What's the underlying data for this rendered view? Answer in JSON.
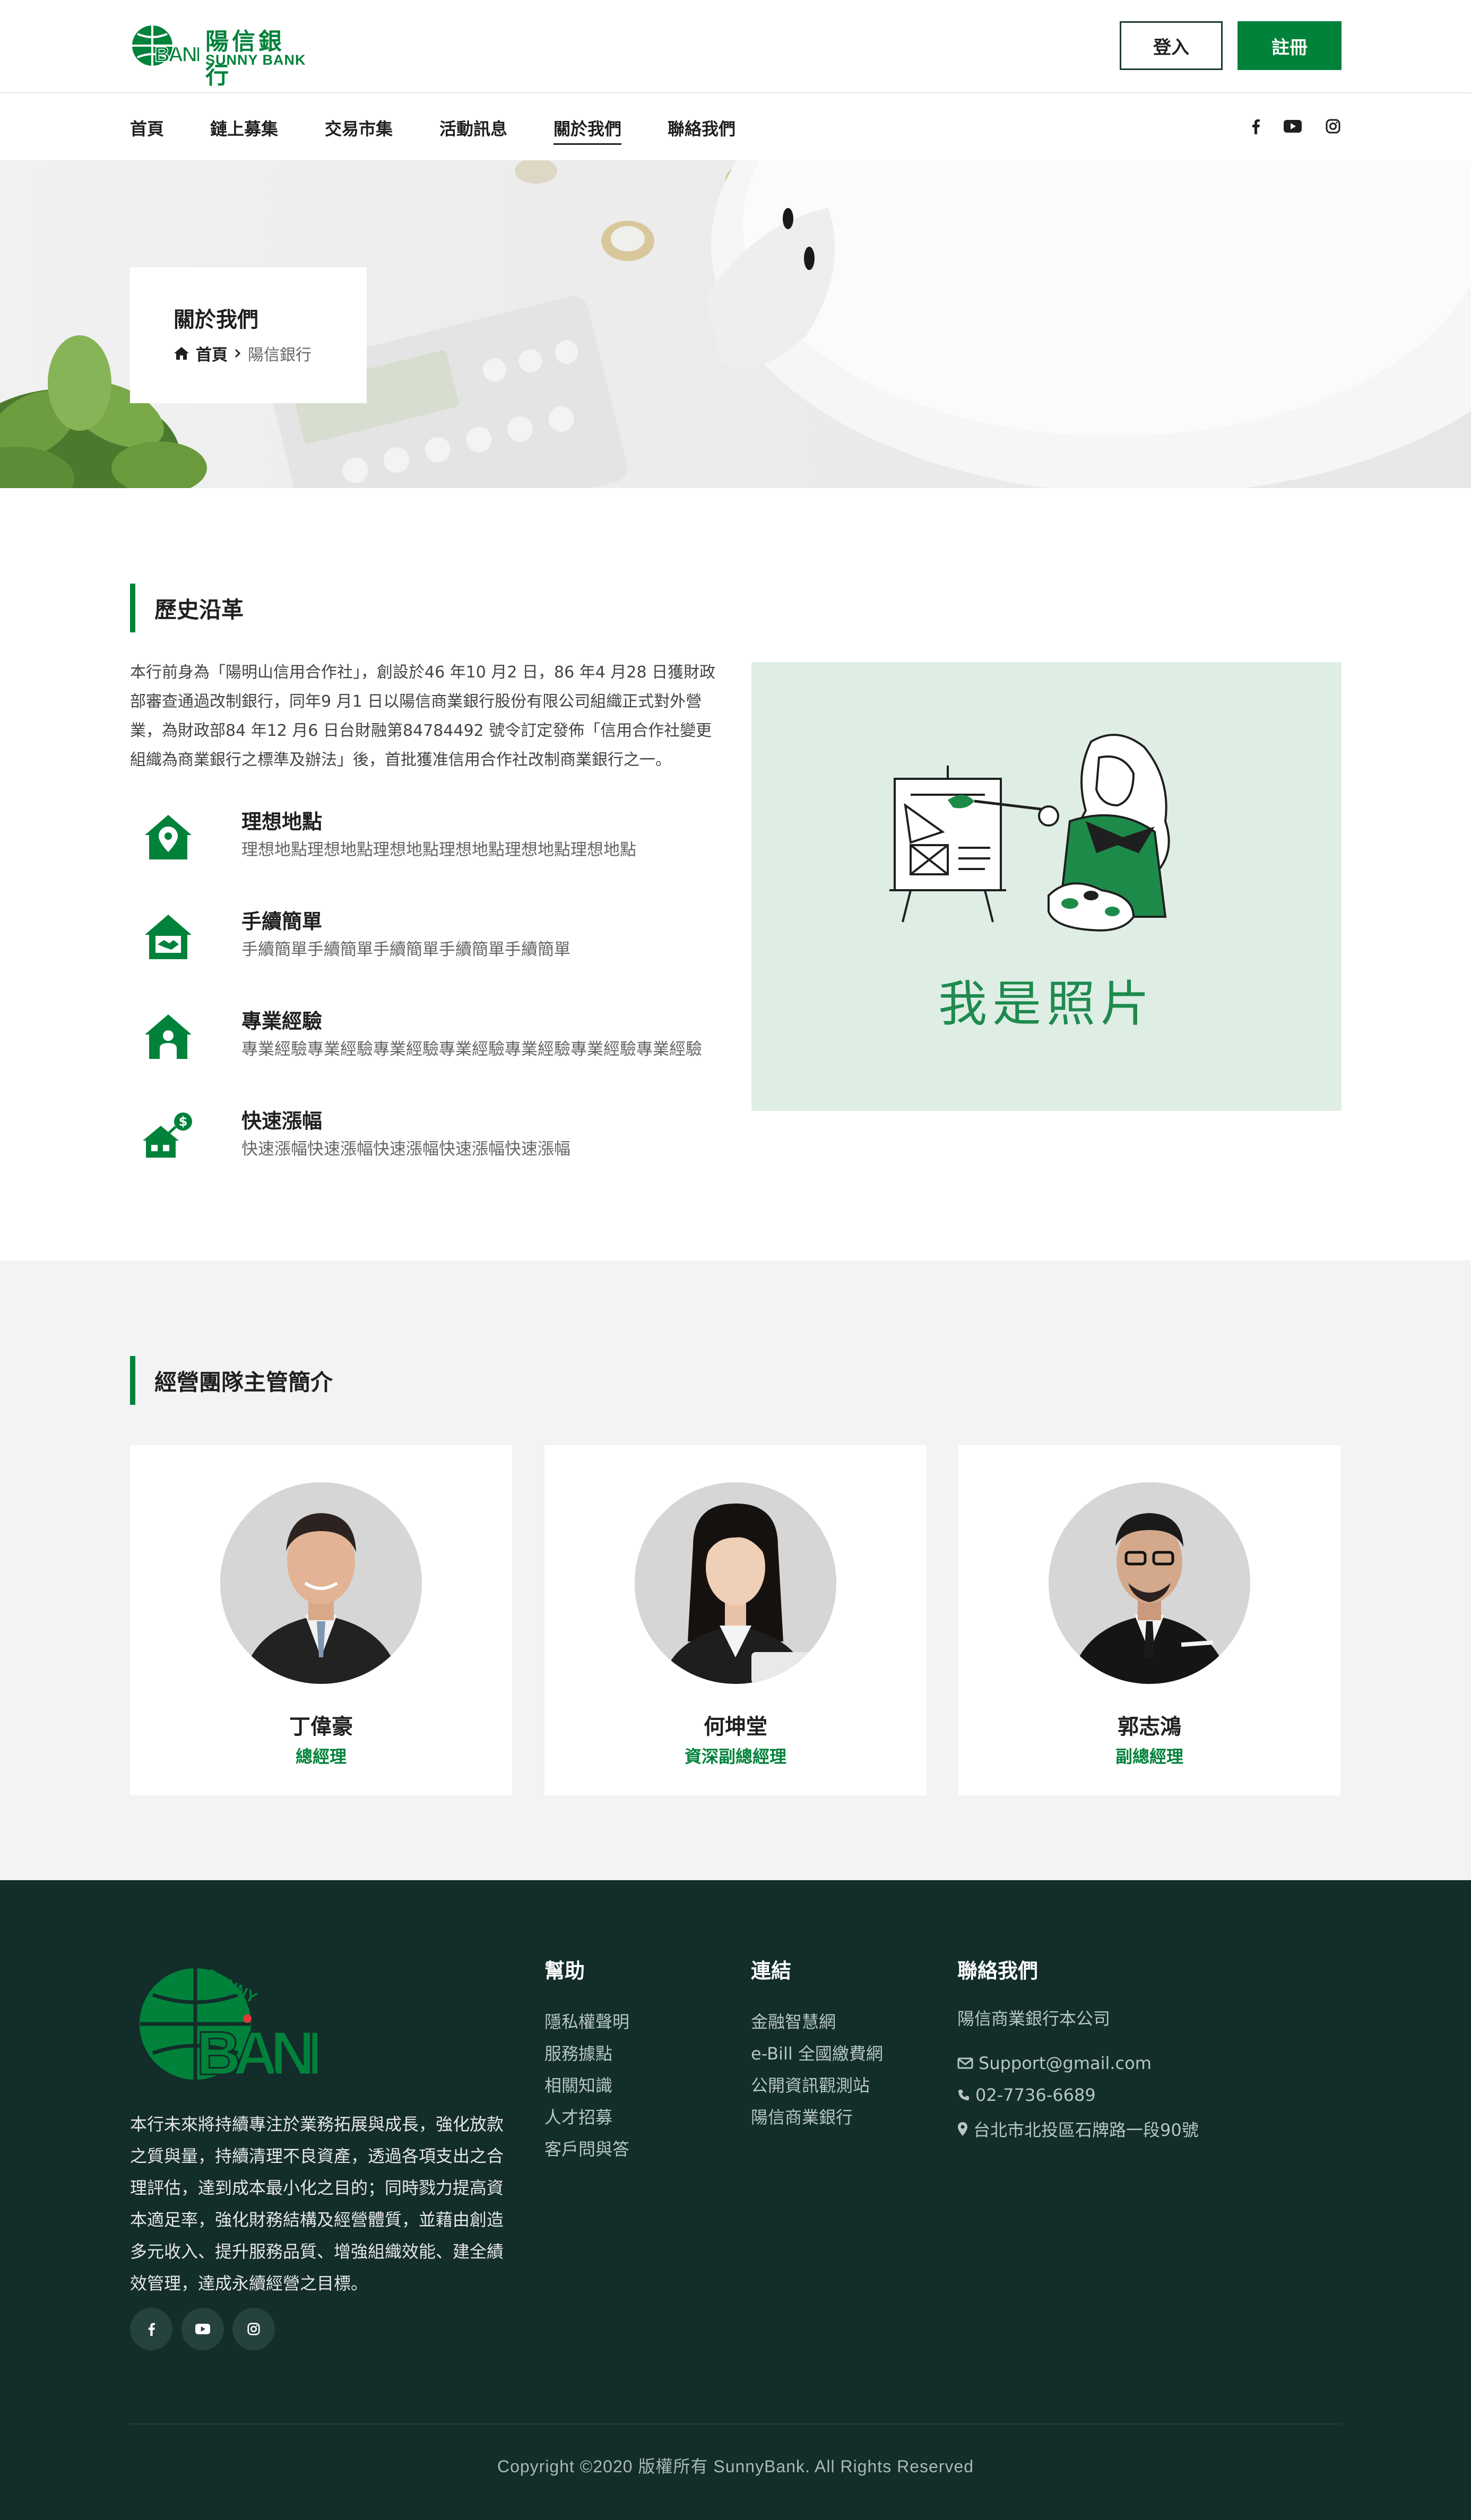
{
  "brand": {
    "name_cn": "陽信銀行",
    "name_en": "SUNNY BANK",
    "logo_mark": "BANK",
    "primary_color": "#00823b",
    "footer_bg": "#122d2a"
  },
  "header": {
    "login_label": "登入",
    "register_label": "註冊"
  },
  "nav": {
    "items": [
      {
        "label": "首頁"
      },
      {
        "label": "鏈上募集"
      },
      {
        "label": "交易市集"
      },
      {
        "label": "活動訊息"
      },
      {
        "label": "關於我們",
        "active": true
      },
      {
        "label": "聯絡我們"
      }
    ],
    "social_icons": [
      "facebook-icon",
      "youtube-icon",
      "instagram-icon"
    ]
  },
  "hero": {
    "title": "關於我們",
    "breadcrumb_home": "首頁",
    "breadcrumb_current": "陽信銀行"
  },
  "history": {
    "heading": "歷史沿革",
    "body": "本行前身為「陽明山信用合作社」，創設於46 年10 月2 日，86 年4 月28 日獲財政部審查通過改制銀行，同年9 月1 日以陽信商業銀行股份有限公司組織正式對外營業，為財政部84 年12 月6 日台財融第84784492 號令訂定發佈「信用合作社變更組織為商業銀行之標準及辦法」後，首批獲准信用合作社改制商業銀行之一。",
    "features": [
      {
        "title": "理想地點",
        "desc": "理想地點理想地點理想地點理想地點理想地點理想地點",
        "icon": "house-location-icon"
      },
      {
        "title": "手續簡單",
        "desc": "手續簡單手續簡單手續簡單手續簡單手續簡單",
        "icon": "house-handshake-icon"
      },
      {
        "title": "專業經驗",
        "desc": "專業經驗專業經驗專業經驗專業經驗專業經驗專業經驗專業經驗",
        "icon": "house-person-icon"
      },
      {
        "title": "快速漲幅",
        "desc": "快速漲幅快速漲幅快速漲幅快速漲幅快速漲幅",
        "icon": "house-growth-icon"
      }
    ],
    "photo_caption": "我是照片"
  },
  "team": {
    "heading": "經營團隊主管簡介",
    "members": [
      {
        "name": "丁偉豪",
        "role": "總經理"
      },
      {
        "name": "何坤堂",
        "role": "資深副總經理"
      },
      {
        "name": "郭志鴻",
        "role": "副總經理"
      }
    ]
  },
  "footer": {
    "logo_text": "SUNNY",
    "about": "本行未來將持續專注於業務拓展與成長，強化放款之質與量，持續清理不良資產，透過各項支出之合理評估，達到成本最小化之目的；同時戮力提高資本適足率，強化財務結構及經營體質，並藉由創造多元收入、提升服務品質、增強組織效能、建全績效管理，達成永續經營之目標。",
    "help": {
      "title": "幫助",
      "links": [
        "隱私權聲明",
        "服務據點",
        "相關知識",
        "人才招募",
        "客戶問與答"
      ]
    },
    "links": {
      "title": "連結",
      "links": [
        "金融智慧網",
        "e-Bill 全國繳費網",
        "公開資訊觀測站",
        "陽信商業銀行"
      ]
    },
    "contact": {
      "title": "聯絡我們",
      "company": "陽信商業銀行本公司",
      "email": "Support@gmail.com",
      "phone": "02-7736-6689",
      "address": "台北市北投區石牌路一段90號"
    },
    "copyright": "Copyright ©2020 版權所有 SunnyBank. All Rights Reserved"
  }
}
